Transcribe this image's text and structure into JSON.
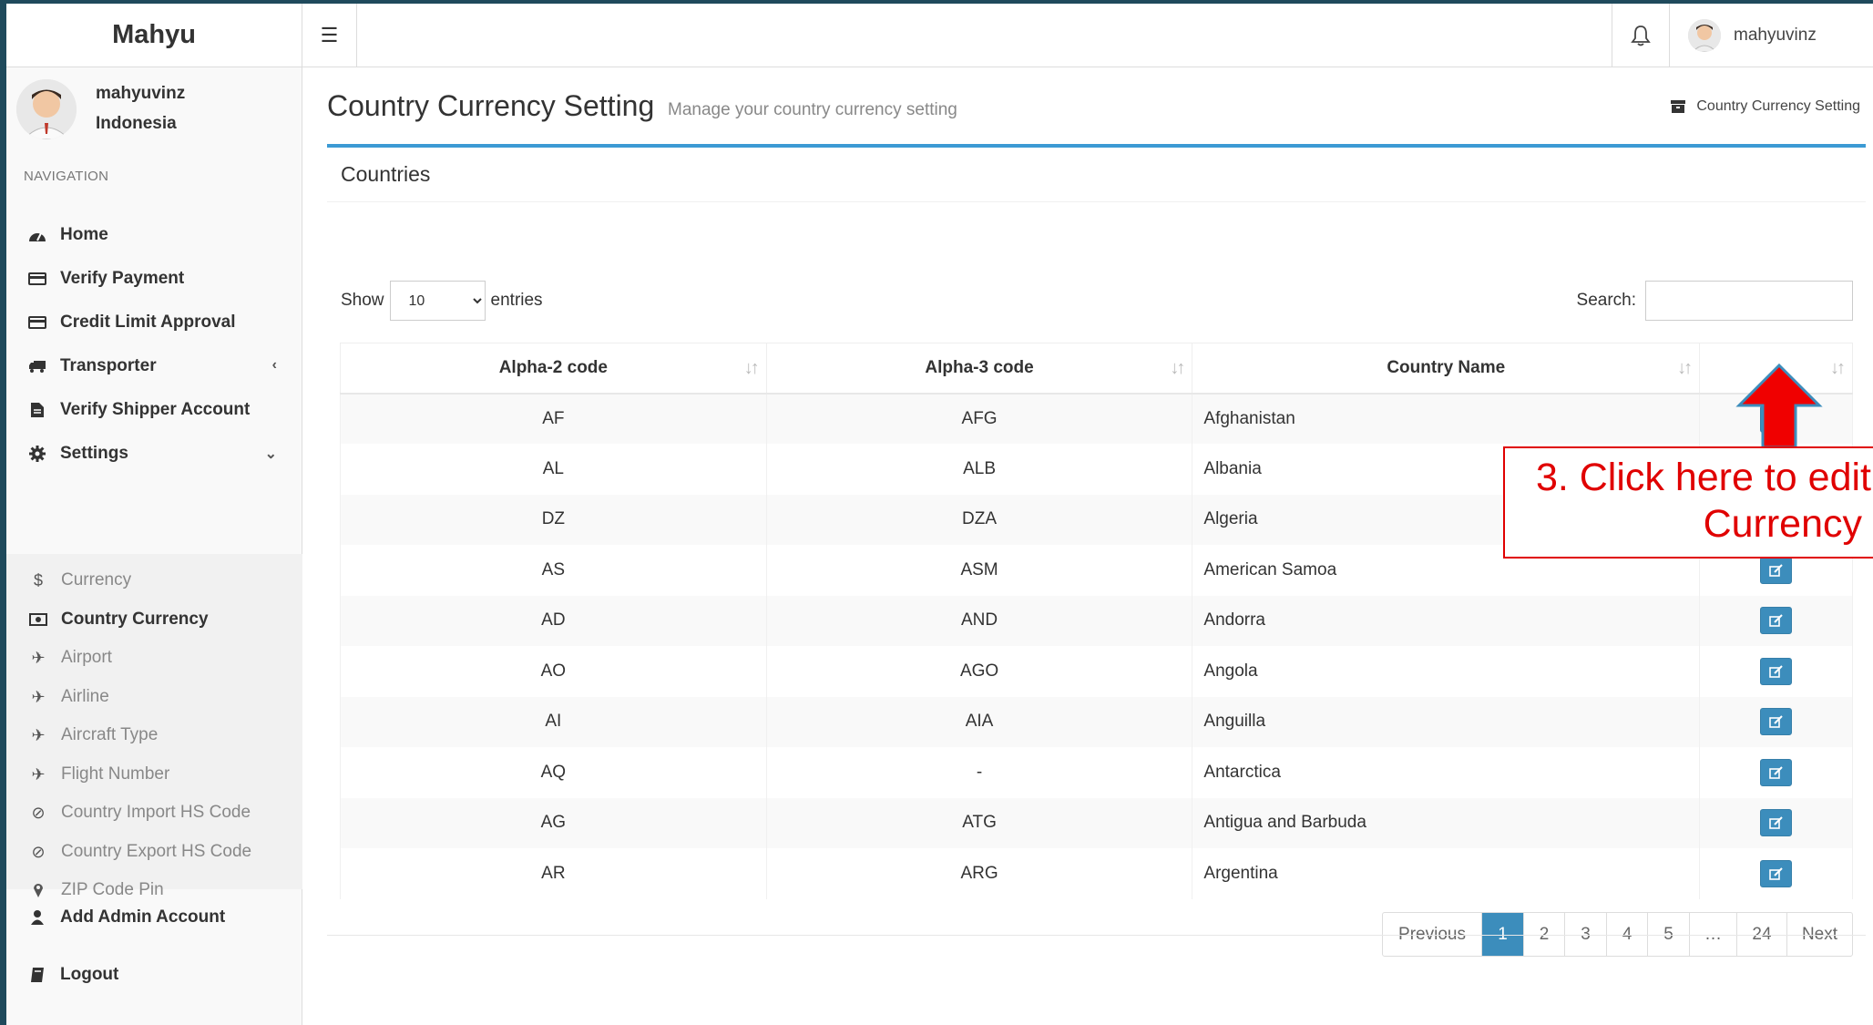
{
  "app": {
    "brand": "Mahyu"
  },
  "topbar": {
    "username": "mahyuvinz"
  },
  "sidebar": {
    "profile": {
      "name": "mahyuvinz",
      "country": "Indonesia"
    },
    "nav_heading": "NAVIGATION",
    "items": [
      {
        "label": "Home",
        "icon": "dashboard-icon"
      },
      {
        "label": "Verify Payment",
        "icon": "credit-card-icon"
      },
      {
        "label": "Credit Limit Approval",
        "icon": "credit-card-icon"
      },
      {
        "label": "Transporter",
        "icon": "truck-icon"
      },
      {
        "label": "Verify Shipper Account",
        "icon": "file-icon"
      },
      {
        "label": "Settings",
        "icon": "gear-icon"
      },
      {
        "label": "Add Admin Account",
        "icon": "user-icon"
      },
      {
        "label": "Logout",
        "icon": "book-icon"
      }
    ],
    "settings_sub": [
      {
        "label": "Currency",
        "icon": "dollar-icon"
      },
      {
        "label": "Country Currency",
        "icon": "money-icon",
        "active": true
      },
      {
        "label": "Airport",
        "icon": "plane-icon"
      },
      {
        "label": "Airline",
        "icon": "plane-icon"
      },
      {
        "label": "Aircraft Type",
        "icon": "plane-icon"
      },
      {
        "label": "Flight Number",
        "icon": "plane-icon"
      },
      {
        "label": "Country Import HS Code",
        "icon": "ban-icon"
      },
      {
        "label": "Country Export HS Code",
        "icon": "ban-icon"
      },
      {
        "label": "ZIP Code Pin",
        "icon": "map-pin-icon"
      }
    ]
  },
  "page": {
    "title": "Country Currency Setting",
    "subtitle": "Manage your country currency setting",
    "breadcrumb": "Country Currency Setting"
  },
  "box": {
    "title": "Countries"
  },
  "controls": {
    "show_label": "Show",
    "entries_value": "10",
    "entries_label": "entries",
    "search_label": "Search:",
    "search_value": ""
  },
  "table": {
    "headers": [
      "Alpha-2 code",
      "Alpha-3 code",
      "Country Name",
      ""
    ],
    "rows": [
      [
        "AF",
        "AFG",
        "Afghanistan"
      ],
      [
        "AL",
        "ALB",
        "Albania"
      ],
      [
        "DZ",
        "DZA",
        "Algeria"
      ],
      [
        "AS",
        "ASM",
        "American Samoa"
      ],
      [
        "AD",
        "AND",
        "Andorra"
      ],
      [
        "AO",
        "AGO",
        "Angola"
      ],
      [
        "AI",
        "AIA",
        "Anguilla"
      ],
      [
        "AQ",
        "-",
        "Antarctica"
      ],
      [
        "AG",
        "ATG",
        "Antigua and Barbuda"
      ],
      [
        "AR",
        "ARG",
        "Argentina"
      ]
    ]
  },
  "pagination": {
    "previous": "Previous",
    "pages": [
      "1",
      "2",
      "3",
      "4",
      "5",
      "…",
      "24"
    ],
    "active": "1",
    "next": "Next"
  },
  "annotation": {
    "line1": "3. Click here to edit",
    "line2": "Currency",
    "color": "#e00000"
  },
  "colors": {
    "accent": "#3c8dbc",
    "box_border": "#3c9ad4"
  }
}
